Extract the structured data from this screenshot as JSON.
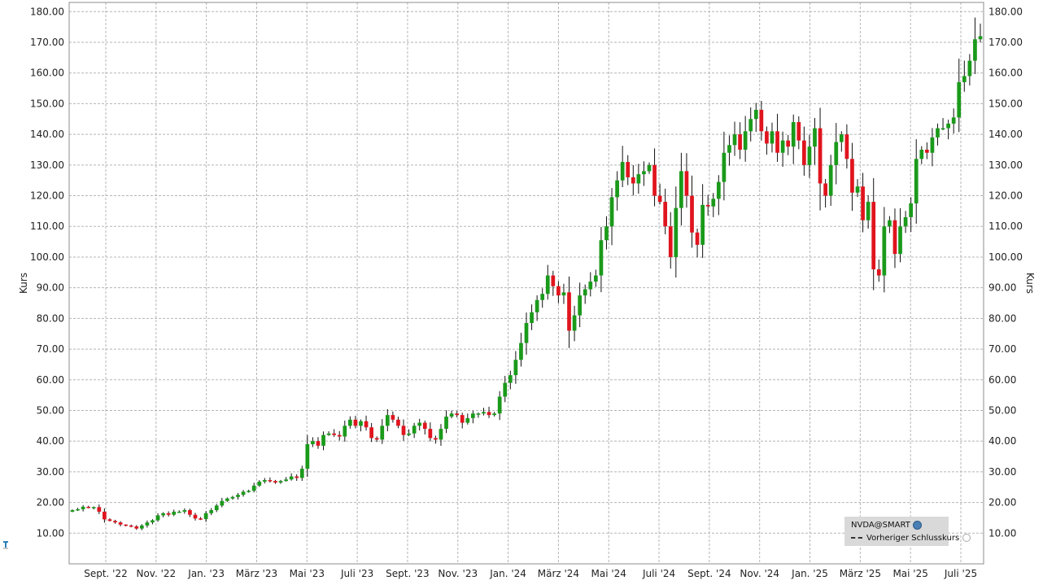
{
  "chart_data": {
    "type": "candlestick",
    "ylabel_left": "Kurs",
    "ylabel_right": "Kurs",
    "y_ticks": [
      "10.00",
      "20.00",
      "30.00",
      "40.00",
      "50.00",
      "60.00",
      "70.00",
      "80.00",
      "90.00",
      "100.00",
      "110.00",
      "120.00",
      "130.00",
      "140.00",
      "150.00",
      "160.00",
      "170.00",
      "180.00"
    ],
    "ylim": [
      0,
      183
    ],
    "x_ticks": [
      "Sept. '22",
      "Nov. '22",
      "Jan. '23",
      "März '23",
      "Mai '23",
      "Juli '23",
      "Sept. '23",
      "Nov. '23",
      "Jan. '24",
      "März '24",
      "Mai '24",
      "Juli '24",
      "Sept. '24",
      "Nov. '24",
      "Jan. '25",
      "März '25",
      "Mai '25",
      "Juli '25"
    ],
    "grid": true,
    "candle_interval": "weekly",
    "up_color": "#1a9a1a",
    "down_color": "#e0141e",
    "close": [
      17.5,
      17.8,
      18.6,
      18.3,
      18.5,
      17.0,
      14.5,
      14.0,
      13.5,
      12.8,
      12.5,
      12.2,
      11.5,
      12.5,
      13.5,
      14.2,
      15.8,
      16.5,
      16.0,
      17.0,
      17.0,
      17.5,
      16.0,
      14.8,
      14.6,
      16.5,
      17.5,
      19.0,
      20.5,
      21.3,
      21.8,
      22.5,
      23.5,
      23.8,
      25.5,
      26.8,
      27.3,
      27.0,
      26.5,
      27.0,
      27.5,
      28.5,
      28.0,
      31.0,
      39.0,
      40.0,
      38.5,
      42.0,
      42.5,
      42.0,
      41.5,
      45.0,
      47.0,
      45.0,
      46.5,
      44.5,
      41.0,
      40.5,
      45.0,
      48.5,
      47.0,
      45.0,
      42.0,
      42.5,
      45.0,
      46.0,
      44.0,
      41.0,
      40.5,
      44.0,
      48.0,
      49.0,
      48.5,
      46.0,
      47.5,
      49.0,
      49.0,
      49.5,
      48.5,
      49.0,
      54.5,
      59.0,
      61.5,
      66.5,
      72.0,
      78.5,
      82.0,
      86.0,
      88.0,
      94.0,
      90.5,
      87.5,
      88.5,
      76.0,
      81.0,
      87.5,
      89.5,
      92.0,
      94.0,
      105.5,
      110.0,
      119.5,
      125.0,
      131.0,
      126.0,
      124.0,
      127.0,
      128.0,
      130.0,
      120.0,
      118.0,
      110.0,
      100.0,
      116.0,
      128.0,
      120.0,
      108.0,
      104.0,
      117.0,
      116.5,
      119.0,
      124.5,
      134.0,
      136.5,
      140.0,
      135.0,
      141.0,
      145.0,
      148.0,
      141.0,
      137.0,
      141.0,
      134.0,
      138.0,
      136.0,
      144.0,
      138.0,
      130.0,
      136.0,
      142.0,
      124.0,
      120.0,
      130.0,
      137.5,
      140.0,
      132.0,
      121.0,
      123.0,
      112.0,
      118.0,
      96.0,
      94.0,
      110.0,
      112.0,
      101.0,
      110.0,
      113.0,
      117.5,
      132.0,
      135.0,
      134.0,
      139.0,
      142.0,
      142.0,
      143.5,
      145.5,
      157.0,
      159.0,
      164.0,
      171.0,
      172.0
    ],
    "annotation": "NVDA@SMART",
    "legend": [
      {
        "label": "NVDA@SMART",
        "icon": "globe-icon"
      },
      {
        "label": "Vorheriger Schlusskurs",
        "style": "dashed-line"
      }
    ]
  }
}
